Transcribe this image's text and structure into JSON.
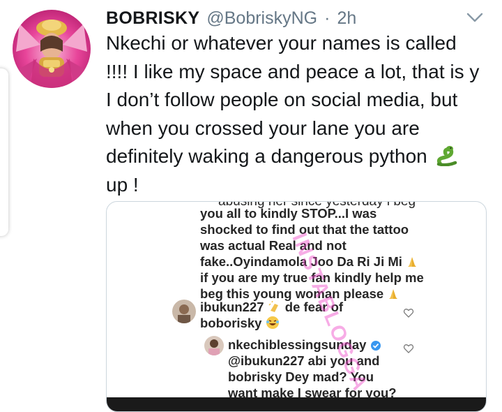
{
  "tweet": {
    "display_name": "BOBRISKY",
    "handle": "@BobriskyNG",
    "separator": "·",
    "time": "2h",
    "text_before_emoji": "Nkechi or whatever your names is called !!!! I like my space and peace a lot, that is y I don’t follow people on social media, but when you crossed your lane you are definitely waking a dangerous python",
    "text_after_emoji": "up !",
    "emoji": "snake-emoji",
    "avatar": "profile-avatar",
    "menu_icon": "chevron-down-icon"
  },
  "media": {
    "cut_text": "abusing her since yesterday i beg",
    "caption_lines": [
      "you all to kindly STOP...I was",
      "shocked to find out that the tattoo",
      "was actual Real and not",
      "fake..Oyindamola Joo Da Ri Ji Mi",
      "if you are my true fan kindly help me",
      "beg this young woman please"
    ],
    "comments": [
      {
        "user": "ibukun227",
        "line1_rest": "de fear of",
        "line2": "boborisky"
      },
      {
        "user": "nkechiblessingsunday",
        "line1": "@ibukun227 abi you and",
        "line2": "bobrisky Dey mad? You",
        "line3": "want make I swear for you?"
      }
    ],
    "watermark": "INSTABLOGGA",
    "colors": {
      "watermark": "#ee46c8",
      "verified": "#3897f0",
      "text": "#262626"
    }
  }
}
